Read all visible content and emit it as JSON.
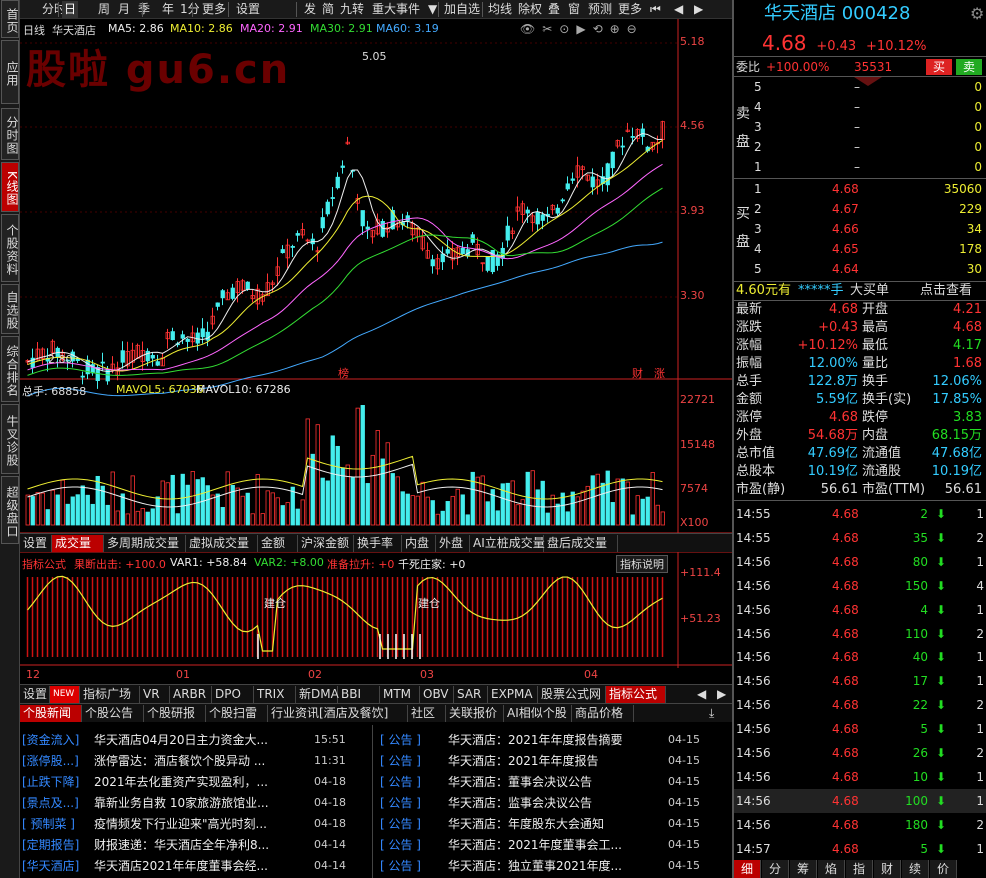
{
  "sidebar": [
    "首页",
    "应用",
    "分时图",
    "K线图",
    "个股资料",
    "自选股",
    "综合排名",
    "牛叉诊股",
    "超级盘口"
  ],
  "toolbar": {
    "left": [
      "分时",
      "日",
      "周",
      "月",
      "季",
      "年",
      "1分",
      "更多",
      "设置"
    ],
    "mid": [
      "发",
      "简",
      "九转",
      "重大事件"
    ],
    "right": [
      "加自选",
      "均线",
      "除权",
      "叠",
      "窗",
      "预测",
      "更多"
    ]
  },
  "kline": {
    "period": "日线",
    "name": "华天酒店",
    "ma5": "MA5: 2.86",
    "ma10": "MA10: 2.86",
    "ma20": "MA20: 2.91",
    "ma30": "MA30: 2.91",
    "ma60": "MA60: 3.19",
    "watermark": "股啦 gu6.cn",
    "high_label": "5.05",
    "low_label": "2.80",
    "price_axis": [
      "5.18",
      "4.56",
      "3.93",
      "3.30"
    ],
    "tags": [
      "榜",
      "财",
      "涨"
    ]
  },
  "volume": {
    "label": "总手: 68858",
    "mavol5": "MAVOL5: 67036",
    "mavol10": "MAVOL10: 67286",
    "axis": [
      "22721",
      "15148",
      "7574",
      "X100"
    ]
  },
  "vol_tabs": [
    "设置",
    "成交量",
    "多周期成交量",
    "虚拟成交量",
    "金额",
    "沪深金额",
    "换手率",
    "内盘",
    "外盘",
    "AI立桩成交量",
    "盘后成交量"
  ],
  "indicator": {
    "name": "指标公式",
    "f1": "果断出击: +100.0",
    "f2": "VAR1: +58.84",
    "f3": "VAR2: +8.00",
    "f4": "准备拉升: +0",
    "f5": "千死庄家: +0",
    "help": "指标说明",
    "axis": [
      "+111.4",
      "+51.23"
    ],
    "labels": [
      "建仓",
      "建仓"
    ]
  },
  "xaxis": [
    "12",
    "01",
    "02",
    "03",
    "04"
  ],
  "ind_tabs": [
    "设置",
    "NEW",
    "指标广场",
    "VR",
    "ARBR",
    "DPO",
    "TRIX",
    "新DMA",
    "BBI",
    "MTM",
    "OBV",
    "SAR",
    "EXPMA",
    "股票公式网",
    "指标公式"
  ],
  "news_tabs": [
    "个股新闻",
    "个股公告",
    "个股研报",
    "个股扫雷",
    "行业资讯[酒店及餐饮]",
    "社区",
    "关联报价",
    "AI相似个股",
    "商品价格"
  ],
  "news_left": [
    {
      "cat": "[资金流入]",
      "text": "华天酒店04月20日主力资金大...",
      "time": "15:51"
    },
    {
      "cat": "[涨停股...]",
      "text": "涨停雷达：酒店餐饮个股异动 ...",
      "time": "11:31"
    },
    {
      "cat": "[止跌下降]",
      "text": "2021年去化重资产实现盈利，...",
      "time": "04-18"
    },
    {
      "cat": "[景点及...]",
      "text": "靠新业务自救 10家旅游旅馆业...",
      "time": "04-18"
    },
    {
      "cat": "[ 预制菜 ]",
      "text": "疫情频发下行业迎来\"高光时刻...",
      "time": "04-18"
    },
    {
      "cat": "[定期报告]",
      "text": "财报速递：华天酒店全年净利8...",
      "time": "04-14"
    },
    {
      "cat": "[华天酒店]",
      "text": "华天酒店2021年年度董事会经...",
      "time": "04-14"
    }
  ],
  "news_right": [
    {
      "cat": "[ 公告 ]",
      "text": "华天酒店：2021年年度报告摘要",
      "time": "04-15"
    },
    {
      "cat": "[ 公告 ]",
      "text": "华天酒店：2021年年度报告",
      "time": "04-15"
    },
    {
      "cat": "[ 公告 ]",
      "text": "华天酒店：董事会决议公告",
      "time": "04-15"
    },
    {
      "cat": "[ 公告 ]",
      "text": "华天酒店：监事会决议公告",
      "time": "04-15"
    },
    {
      "cat": "[ 公告 ]",
      "text": "华天酒店：年度股东大会通知",
      "time": "04-15"
    },
    {
      "cat": "[ 公告 ]",
      "text": "华天酒店：2021年度董事会工...",
      "time": "04-15"
    },
    {
      "cat": "[ 公告 ]",
      "text": "华天酒店：独立董事2021年度...",
      "time": "04-15"
    }
  ],
  "quote": {
    "name": "华天酒店",
    "code": "000428",
    "price": "4.68",
    "chg": "+0.43",
    "pct": "+10.12%",
    "weibi": "委比",
    "weibi_v": "+100.00%",
    "weicha": "35531",
    "buy": "买",
    "sell": "卖"
  },
  "asks": [
    [
      "5",
      "–",
      "0"
    ],
    [
      "4",
      "–",
      "0"
    ],
    [
      "3",
      "–",
      "0"
    ],
    [
      "2",
      "–",
      "0"
    ],
    [
      "1",
      "–",
      "0"
    ]
  ],
  "bids": [
    [
      "1",
      "4.68",
      "35060"
    ],
    [
      "2",
      "4.67",
      "229"
    ],
    [
      "3",
      "4.66",
      "34"
    ],
    [
      "4",
      "4.65",
      "178"
    ],
    [
      "5",
      "4.64",
      "30"
    ]
  ],
  "ask_label": [
    "卖",
    "盘"
  ],
  "bid_label": [
    "买",
    "盘"
  ],
  "big_order": {
    "price": "4.60元有",
    "hands": "*****手",
    "title": "大买单",
    "link": "点击查看"
  },
  "stats": [
    [
      "最新",
      "4.68",
      "开盘",
      "4.21"
    ],
    [
      "涨跌",
      "+0.43",
      "最高",
      "4.68"
    ],
    [
      "涨幅",
      "+10.12%",
      "最低",
      "4.17"
    ],
    [
      "振幅",
      "12.00%",
      "量比",
      "1.68"
    ],
    [
      "总手",
      "122.8万",
      "换手",
      "12.06%"
    ],
    [
      "金额",
      "5.59亿",
      "换手(实)",
      "17.85%"
    ],
    [
      "涨停",
      "4.68",
      "跌停",
      "3.83"
    ],
    [
      "外盘",
      "54.68万",
      "内盘",
      "68.15万"
    ],
    [
      "总市值",
      "47.69亿",
      "流通值",
      "47.68亿"
    ],
    [
      "总股本",
      "10.19亿",
      "流通股",
      "10.19亿"
    ],
    [
      "市盈(静)",
      "56.61",
      "市盈(TTM)",
      "56.61"
    ]
  ],
  "ticks": [
    [
      "14:55",
      "4.68",
      "2",
      "1"
    ],
    [
      "14:55",
      "4.68",
      "35",
      "2"
    ],
    [
      "14:56",
      "4.68",
      "80",
      "1"
    ],
    [
      "14:56",
      "4.68",
      "150",
      "4"
    ],
    [
      "14:56",
      "4.68",
      "4",
      "1"
    ],
    [
      "14:56",
      "4.68",
      "110",
      "2"
    ],
    [
      "14:56",
      "4.68",
      "40",
      "1"
    ],
    [
      "14:56",
      "4.68",
      "17",
      "1"
    ],
    [
      "14:56",
      "4.68",
      "22",
      "2"
    ],
    [
      "14:56",
      "4.68",
      "5",
      "1"
    ],
    [
      "14:56",
      "4.68",
      "26",
      "2"
    ],
    [
      "14:56",
      "4.68",
      "10",
      "1"
    ],
    [
      "14:56",
      "4.68",
      "100",
      "1"
    ],
    [
      "14:56",
      "4.68",
      "180",
      "2"
    ],
    [
      "14:57",
      "4.68",
      "5",
      "1"
    ]
  ],
  "bottom_tabs": [
    "细",
    "分",
    "筹",
    "焰",
    "指",
    "财",
    "续",
    "价"
  ]
}
